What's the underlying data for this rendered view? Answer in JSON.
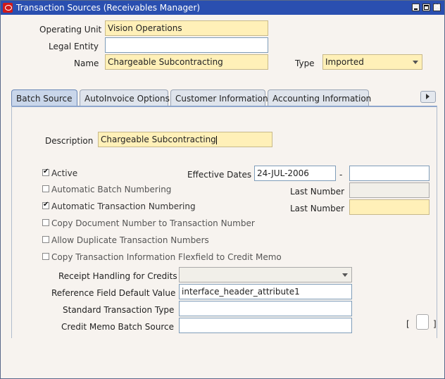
{
  "window": {
    "title": "Transaction Sources (Receivables Manager)"
  },
  "header": {
    "operating_unit_label": "Operating Unit",
    "operating_unit_value": "Vision Operations",
    "legal_entity_label": "Legal Entity",
    "legal_entity_value": "",
    "name_label": "Name",
    "name_value": "Chargeable Subcontracting",
    "type_label": "Type",
    "type_value": "Imported"
  },
  "tabs": [
    {
      "label": "Batch Source"
    },
    {
      "label": "AutoInvoice Options"
    },
    {
      "label": "Customer Information"
    },
    {
      "label": "Accounting Information"
    }
  ],
  "batch_source": {
    "description_label": "Description",
    "description_value": "Chargeable Subcontracting",
    "effective_dates_label": "Effective Dates",
    "effective_from": "24-JUL-2006",
    "date_sep": "-",
    "effective_to": "",
    "last_number_label_1": "Last Number",
    "last_number_1": "",
    "last_number_label_2": "Last Number",
    "last_number_2": "",
    "checkboxes": [
      {
        "label": "Active",
        "checked": true
      },
      {
        "label": "Automatic Batch Numbering",
        "checked": false
      },
      {
        "label": "Automatic Transaction Numbering",
        "checked": true
      },
      {
        "label": "Copy Document Number to Transaction Number",
        "checked": false
      },
      {
        "label": "Allow Duplicate Transaction Numbers",
        "checked": false
      },
      {
        "label": "Copy Transaction Information Flexfield to Credit Memo",
        "checked": false
      }
    ],
    "receipt_handling_label": "Receipt Handling for Credits",
    "receipt_handling_value": "",
    "reference_field_label": "Reference Field Default Value",
    "reference_field_value": "interface_header_attribute1",
    "standard_type_label": "Standard Transaction Type",
    "standard_type_value": "",
    "credit_memo_label": "Credit Memo Batch Source",
    "credit_memo_value": "",
    "flex_open": "[",
    "flex_close": "]"
  }
}
